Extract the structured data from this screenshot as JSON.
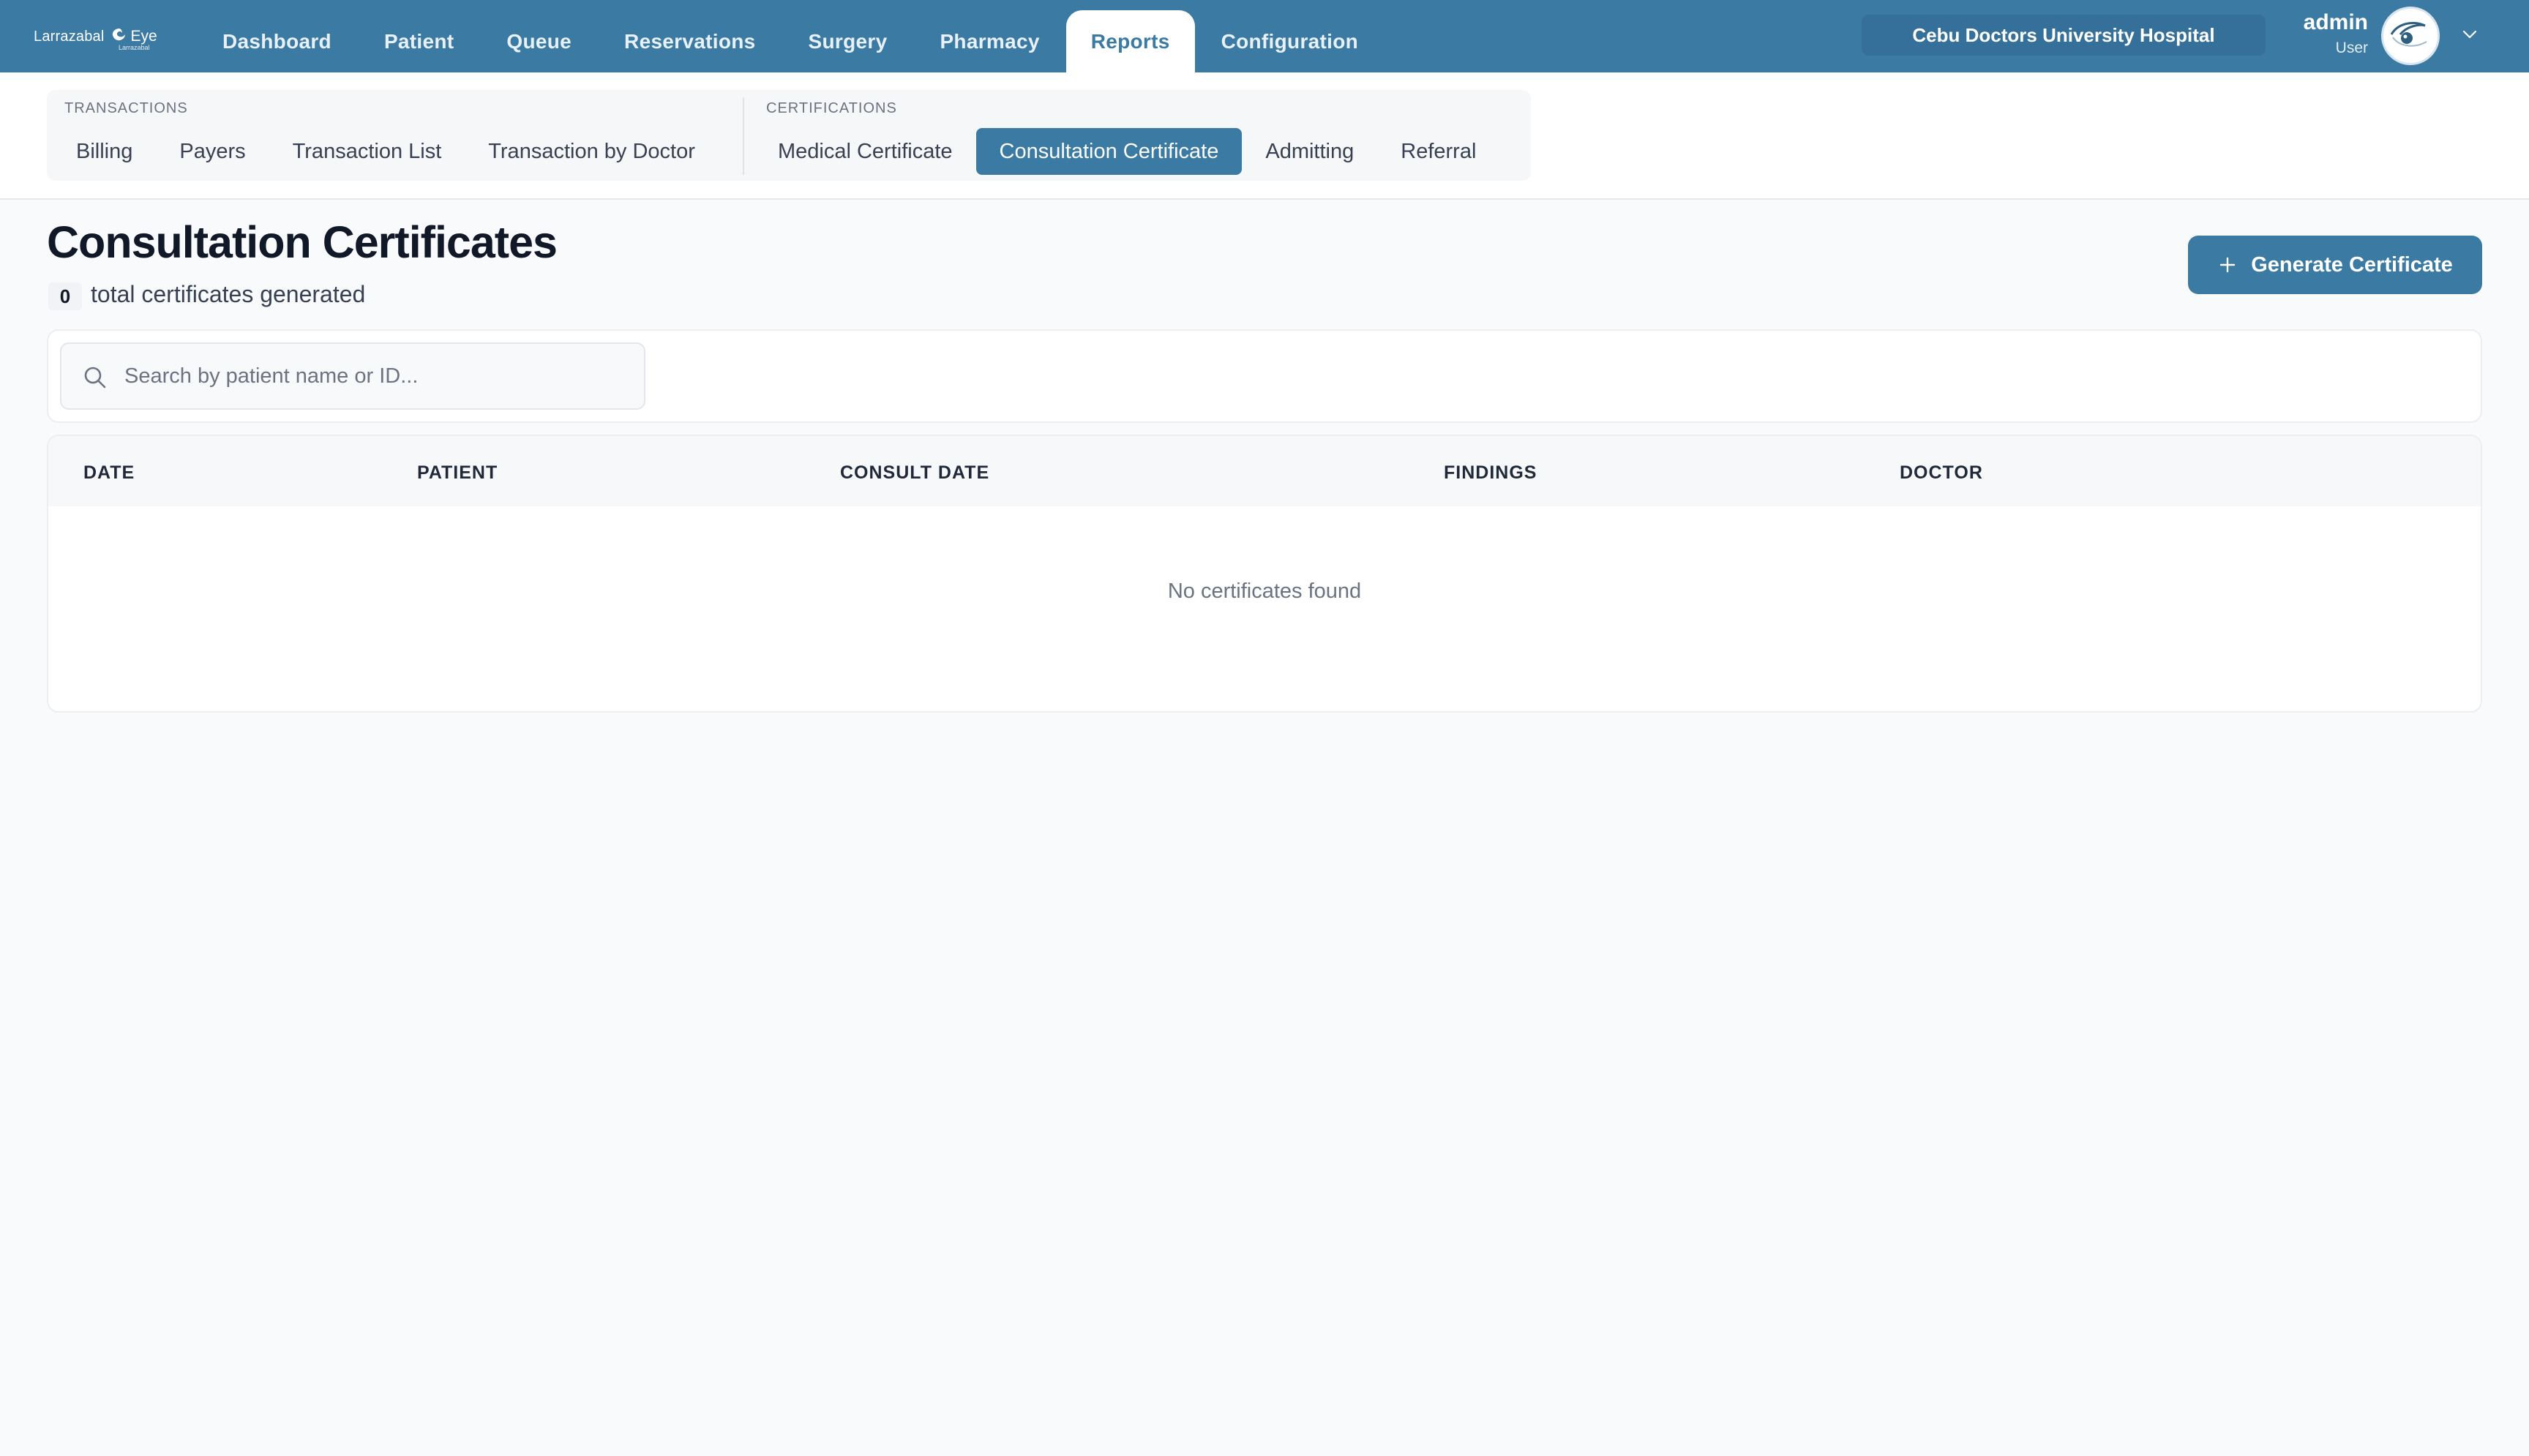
{
  "brand": {
    "name": "Larrazabal",
    "eye": "Eye",
    "sub": "Larrazabal"
  },
  "nav": {
    "items": [
      {
        "label": "Dashboard",
        "active": false
      },
      {
        "label": "Patient",
        "active": false
      },
      {
        "label": "Queue",
        "active": false
      },
      {
        "label": "Reservations",
        "active": false
      },
      {
        "label": "Surgery",
        "active": false
      },
      {
        "label": "Pharmacy",
        "active": false
      },
      {
        "label": "Reports",
        "active": true
      },
      {
        "label": "Configuration",
        "active": false
      }
    ]
  },
  "header": {
    "hospital": "Cebu Doctors University Hospital",
    "user_name": "admin",
    "user_role": "User",
    "avatar_icon": "eye-avatar-icon",
    "chevron_icon": "chevron-down-icon"
  },
  "subnav": {
    "transactions": {
      "title": "TRANSACTIONS",
      "items": [
        "Billing",
        "Payers",
        "Transaction List",
        "Transaction by Doctor"
      ]
    },
    "certifications": {
      "title": "CERTIFICATIONS",
      "items": [
        "Medical Certificate",
        "Consultation Certificate",
        "Admitting",
        "Referral"
      ],
      "active": "Consultation Certificate"
    }
  },
  "page": {
    "title": "Consultation Certificates",
    "count": "0",
    "count_label": "total certificates generated",
    "generate_label": "Generate Certificate"
  },
  "search": {
    "placeholder": "Search by patient name or ID...",
    "value": ""
  },
  "table": {
    "columns": [
      "DATE",
      "PATIENT",
      "CONSULT DATE",
      "FINDINGS",
      "DOCTOR"
    ],
    "rows": [],
    "empty_message": "No certificates found"
  },
  "colors": {
    "primary": "#3a7aa3",
    "background": "#f8fafc"
  }
}
